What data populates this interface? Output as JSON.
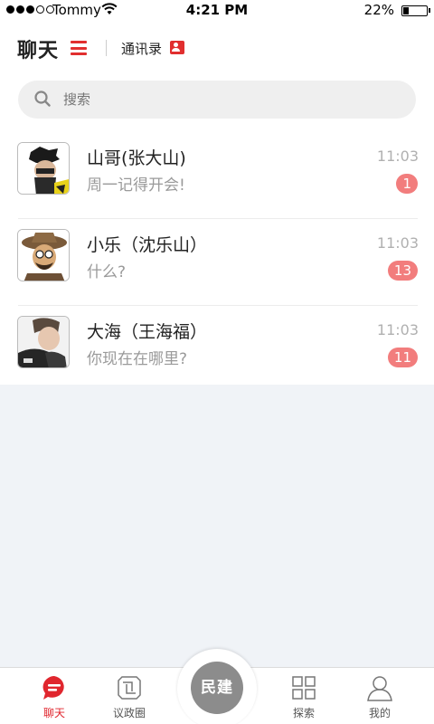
{
  "status_bar": {
    "carrier": "Tommy",
    "time": "4:21 PM",
    "battery_percent": "22%",
    "battery_level": 0.22,
    "signal_bars_filled": 3,
    "signal_bars_total": 5
  },
  "header": {
    "title": "聊天",
    "contacts_label": "通讯录",
    "accent_color": "#e12f2f"
  },
  "search": {
    "placeholder": "搜索"
  },
  "chats": [
    {
      "name": "山哥(张大山)",
      "message": "周一记得开会!",
      "time": "11:03",
      "unread": "1"
    },
    {
      "name": "小乐（沈乐山）",
      "message": "什么?",
      "time": "11:03",
      "unread": "13"
    },
    {
      "name": "大海（王海福）",
      "message": "你现在在哪里?",
      "time": "11:03",
      "unread": "11"
    }
  ],
  "tabbar": {
    "chat_label": "聊天",
    "discuss_label": "议政圈",
    "center_label": "民建",
    "explore_label": "探索",
    "mine_label": "我的",
    "active_color": "#e0262e",
    "icons": [
      "chat-bubble-icon",
      "discussion-circle-icon",
      "explore-grid-icon",
      "profile-icon"
    ]
  }
}
